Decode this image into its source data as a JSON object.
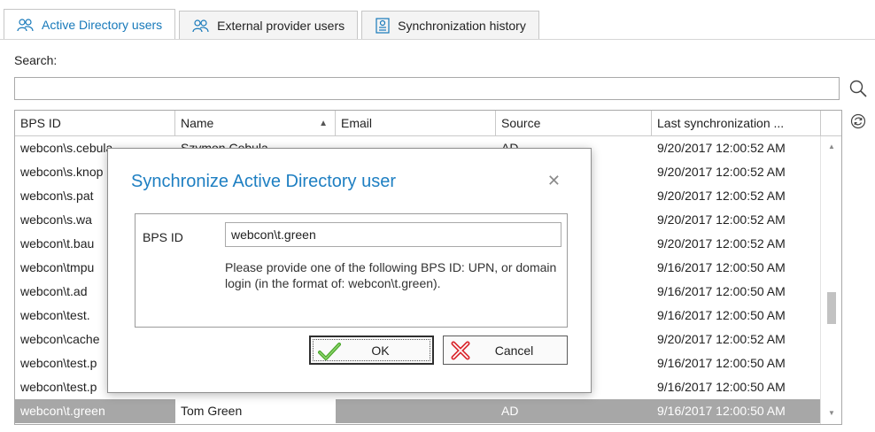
{
  "tabs": [
    {
      "label": "Active Directory users",
      "active": true
    },
    {
      "label": "External provider users",
      "active": false
    },
    {
      "label": "Synchronization history",
      "active": false
    }
  ],
  "search": {
    "label": "Search:",
    "value": "",
    "placeholder": ""
  },
  "grid": {
    "columns": [
      "BPS ID",
      "Name",
      "Email",
      "Source",
      "Last synchronization ..."
    ],
    "sort_column": "Name",
    "sort_direction": "ascending",
    "rows": [
      {
        "bps_id": "webcon\\s.cebula",
        "name": "Szymon Cebula",
        "email": "",
        "source": "AD",
        "last_sync": "9/20/2017 12:00:52 AM"
      },
      {
        "bps_id": "webcon\\s.knop",
        "name": "",
        "email": "",
        "source": "",
        "last_sync": "9/20/2017 12:00:52 AM"
      },
      {
        "bps_id": "webcon\\s.pat",
        "name": "",
        "email": "",
        "source": "",
        "last_sync": "9/20/2017 12:00:52 AM"
      },
      {
        "bps_id": "webcon\\s.wa",
        "name": "",
        "email": "",
        "source": "",
        "last_sync": "9/20/2017 12:00:52 AM"
      },
      {
        "bps_id": "webcon\\t.bau",
        "name": "",
        "email": "",
        "source": "",
        "last_sync": "9/20/2017 12:00:52 AM"
      },
      {
        "bps_id": "webcon\\tmpu",
        "name": "",
        "email": "",
        "source": "",
        "last_sync": "9/16/2017 12:00:50 AM"
      },
      {
        "bps_id": "webcon\\t.ad",
        "name": "",
        "email": "",
        "source": "",
        "last_sync": "9/16/2017 12:00:50 AM"
      },
      {
        "bps_id": "webcon\\test.",
        "name": "",
        "email": "",
        "source": "",
        "last_sync": "9/16/2017 12:00:50 AM"
      },
      {
        "bps_id": "webcon\\cache",
        "name": "",
        "email": "",
        "source": "",
        "last_sync": "9/20/2017 12:00:52 AM"
      },
      {
        "bps_id": "webcon\\test.p",
        "name": "",
        "email": "",
        "source": "",
        "last_sync": "9/16/2017 12:00:50 AM"
      },
      {
        "bps_id": "webcon\\test.p",
        "name": "",
        "email": "",
        "source": "",
        "last_sync": "9/16/2017 12:00:50 AM"
      },
      {
        "bps_id": "webcon\\t.green",
        "name": "Tom Green",
        "email": "",
        "source": "AD",
        "last_sync": "9/16/2017 12:00:50 AM",
        "selected": true
      }
    ],
    "scroll_position": 0.85
  },
  "dialog": {
    "title": "Synchronize Active Directory user",
    "field_label": "BPS ID",
    "field_value": "webcon\\t.green",
    "help_text": "Please provide one of the following BPS ID: UPN, or domain login (in the format of: webcon\\t.green).",
    "ok_label": "OK",
    "cancel_label": "Cancel"
  },
  "colors": {
    "accent": "#1e7fc2",
    "selected_row": "#a7a7a7",
    "ok_icon": "#4aa82b",
    "cancel_icon": "#d9262c"
  }
}
